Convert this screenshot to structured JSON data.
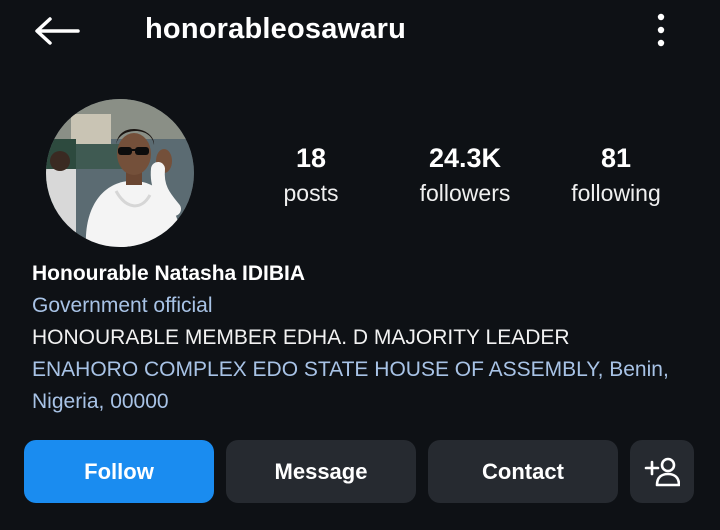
{
  "header": {
    "username": "honorableosawaru",
    "back_icon": "arrow-left-icon",
    "more_icon": "kebab-menu-icon"
  },
  "profile": {
    "avatar_icon": "profile-photo",
    "stats": {
      "posts_count": "18",
      "posts_label": "posts",
      "followers_count": "24.3K",
      "followers_label": "followers",
      "following_count": "81",
      "following_label": "following"
    }
  },
  "bio": {
    "name": "Honourable Natasha IDIBIA",
    "category": "Government official",
    "description": "HONOURABLE MEMBER EDHA. D MAJORITY LEADER",
    "address_line1": "ENAHORO COMPLEX EDO STATE HOUSE OF ASSEMBLY, Benin,",
    "address_line2": "Nigeria, 00000"
  },
  "actions": {
    "follow_label": "Follow",
    "message_label": "Message",
    "contact_label": "Contact",
    "add_user_icon": "add-person-icon"
  },
  "colors": {
    "background": "#0e1115",
    "follow_button": "#1a8cf0",
    "secondary_button": "#262a30",
    "link_text": "#a8c3e6"
  }
}
